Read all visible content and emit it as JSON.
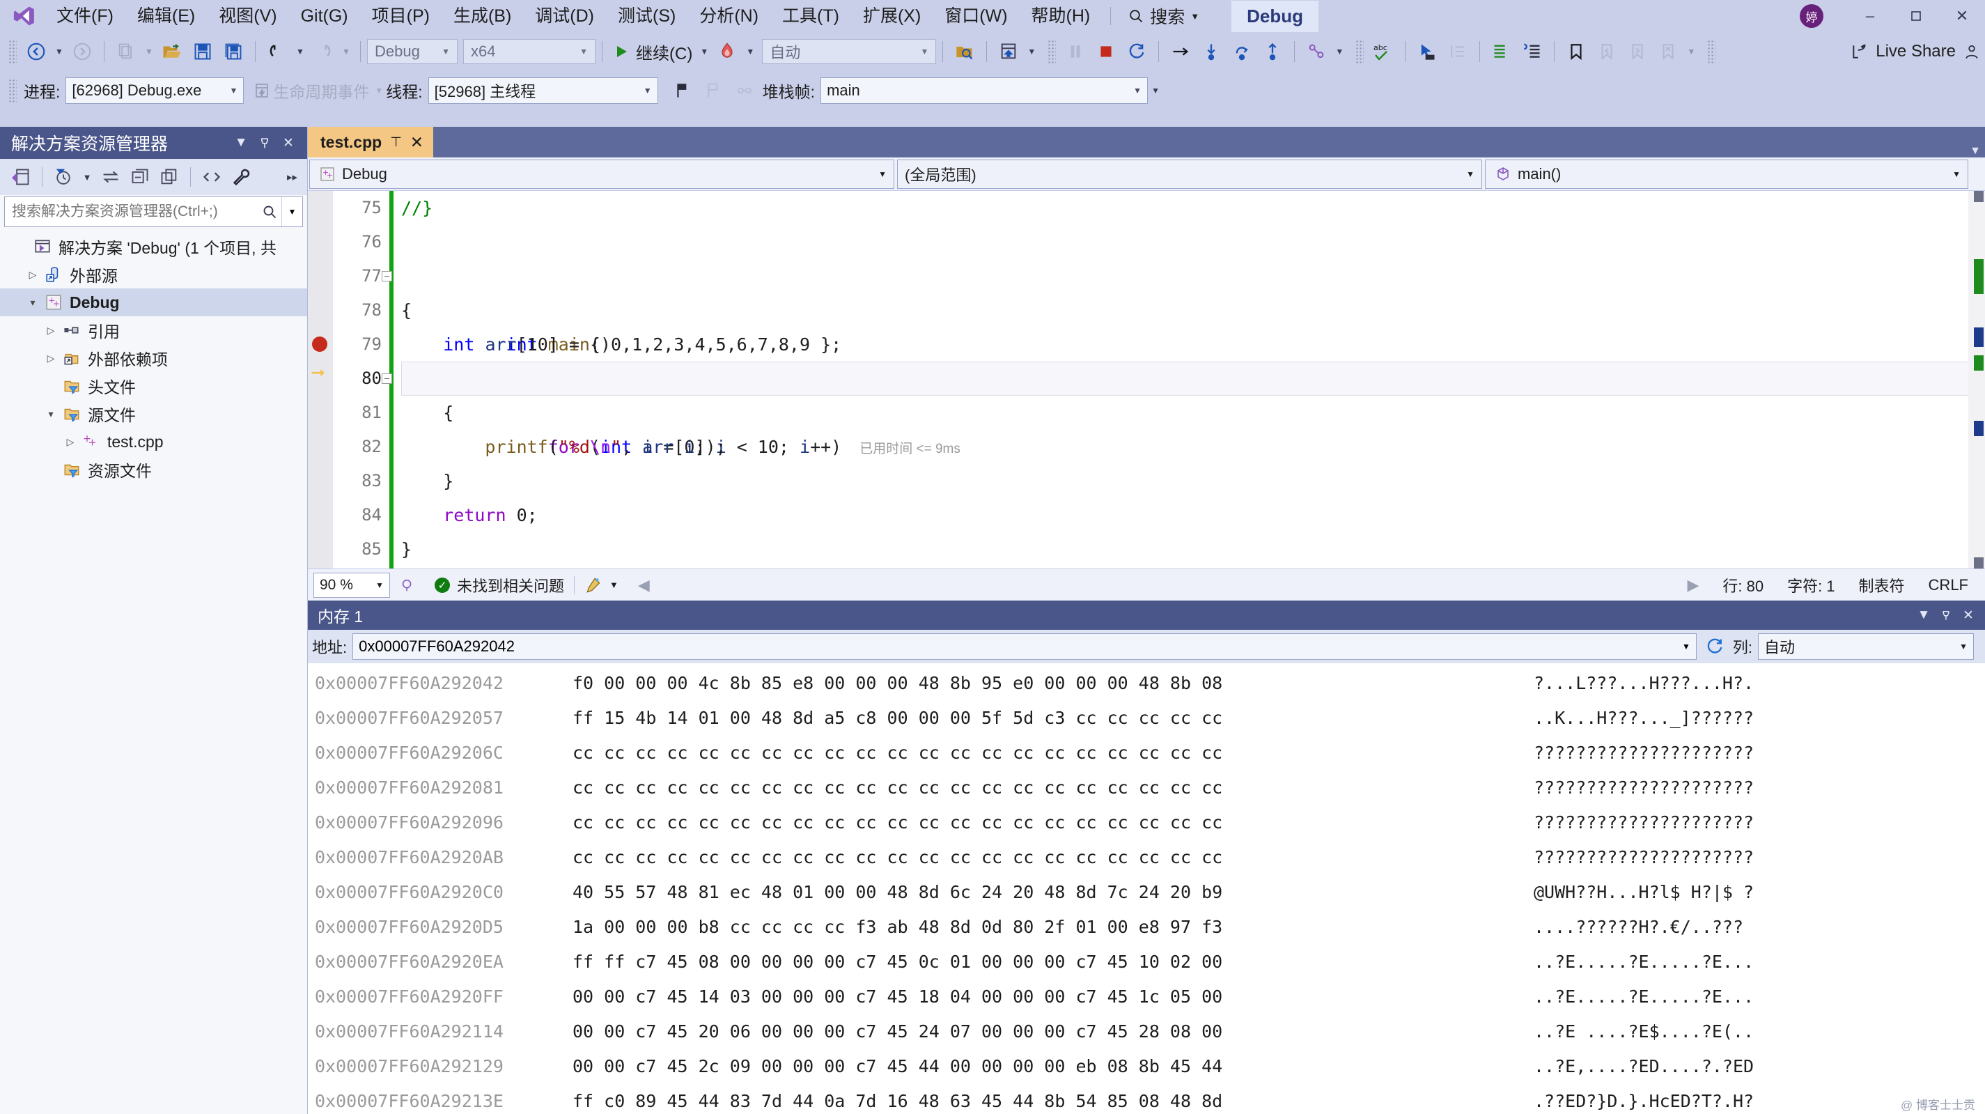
{
  "titlebar": {
    "logo_icon": "visual-studio-logo",
    "menus": [
      "文件(F)",
      "编辑(E)",
      "视图(V)",
      "Git(G)",
      "项目(P)",
      "生成(B)",
      "调试(D)",
      "测试(S)",
      "分析(N)",
      "工具(T)",
      "扩展(X)",
      "窗口(W)",
      "帮助(H)"
    ],
    "search_label": "搜索",
    "profile_tag": "Debug",
    "avatar_initial": "婷",
    "minimize_icon": "minimize-icon",
    "restore_icon": "restore-icon",
    "close_icon": "close-icon"
  },
  "toolbar": {
    "back_icon": "navigate-back-icon",
    "forward_icon": "navigate-forward-icon",
    "new_icon": "new-item-icon",
    "open_icon": "open-folder-icon",
    "save_icon": "save-icon",
    "save_all_icon": "save-all-icon",
    "undo_icon": "undo-icon",
    "redo_icon": "redo-icon",
    "config_value": "Debug",
    "platform_value": "x64",
    "continue_label": "继续(C)",
    "hot_reload_icon": "hot-reload-icon",
    "auto_value": "自动",
    "attach_icon": "attach-to-process-icon",
    "window_icon": "show-window-icon",
    "pause_icon": "pause-icon",
    "stop_icon": "stop-icon",
    "restart_icon": "restart-icon",
    "step_over_icon": "step-over-icon",
    "step_into_icon": "step-into-icon",
    "step_out_icon": "step-out-icon",
    "thread_icon": "threads-icon",
    "spell_icon": "spell-check-icon",
    "pointer_icon": "pointer-icon",
    "indent_icon": "indent-icon",
    "comment_icon": "comment-icon",
    "uncomment_icon": "uncomment-icon",
    "bookmark_icon": "bookmark-icon",
    "prev_bookmark_icon": "previous-bookmark-icon",
    "next_bookmark_icon": "next-bookmark-icon",
    "clear_bookmark_icon": "clear-bookmarks-icon",
    "live_share_label": "Live Share",
    "live_share_icon": "live-share-icon"
  },
  "debugbar": {
    "process_label": "进程:",
    "process_value": "[62968] Debug.exe",
    "lifecycle_label": "生命周期事件",
    "lifecycle_icon": "lifecycle-events-icon",
    "thread_label": "线程:",
    "thread_value": "[52968] 主线程",
    "flag_icon": "flag-icon",
    "flag2_icon": "flag-outline-icon",
    "link_icon": "link-icon",
    "stackframe_label": "堆栈帧:",
    "stackframe_value": "main"
  },
  "solution_explorer": {
    "title": "解决方案资源管理器",
    "dropdown_icon": "chevron-down-icon",
    "pin_icon": "pin-icon",
    "close_icon": "close-icon",
    "toolbar_icons": [
      "home-view-icon",
      "pending-changes-icon",
      "sync-icon",
      "collapse-all-icon",
      "show-all-files-icon",
      "code-view-icon",
      "properties-icon"
    ],
    "search_placeholder": "搜索解决方案资源管理器(Ctrl+;)",
    "search_icon": "search-icon",
    "tree": [
      {
        "label": "解决方案 'Debug' (1 个项目, 共",
        "icon": "solution-icon",
        "indent": 0,
        "arrow": "none",
        "bold": false,
        "selected": false
      },
      {
        "label": "外部源",
        "icon": "external-sources-icon",
        "indent": 1,
        "arrow": "collapsed",
        "bold": false,
        "selected": false
      },
      {
        "label": "Debug",
        "icon": "cpp-project-icon",
        "indent": 1,
        "arrow": "expanded",
        "bold": true,
        "selected": true
      },
      {
        "label": "引用",
        "icon": "references-icon",
        "indent": 2,
        "arrow": "collapsed",
        "bold": false,
        "selected": false
      },
      {
        "label": "外部依赖项",
        "icon": "external-dependencies-icon",
        "indent": 2,
        "arrow": "collapsed",
        "bold": false,
        "selected": false
      },
      {
        "label": "头文件",
        "icon": "filter-folder-icon",
        "indent": 2,
        "arrow": "none",
        "bold": false,
        "selected": false
      },
      {
        "label": "源文件",
        "icon": "filter-folder-icon",
        "indent": 2,
        "arrow": "expanded",
        "bold": false,
        "selected": false
      },
      {
        "label": "test.cpp",
        "icon": "cpp-file-icon",
        "indent": 3,
        "arrow": "collapsed",
        "bold": false,
        "selected": false
      },
      {
        "label": "资源文件",
        "icon": "filter-folder-icon",
        "indent": 2,
        "arrow": "none",
        "bold": false,
        "selected": false
      }
    ]
  },
  "editor": {
    "tab_label": "test.cpp",
    "tab_pin_icon": "pin-icon",
    "tab_close_icon": "close-icon",
    "project_scope": "Debug",
    "project_scope_icon": "cpp-project-icon",
    "global_scope": "(全局范围)",
    "member_scope": "main()",
    "member_scope_icon": "method-icon",
    "breakpoint_line": 79,
    "current_line": 80,
    "elapsed_label": "已用时间 <= 9ms",
    "lines": [
      {
        "no": 75,
        "html": "<span class=\"cmt\">//}</span>",
        "text": "//}"
      },
      {
        "no": 76,
        "html": "",
        "text": ""
      },
      {
        "no": 77,
        "html": "<span class=\"kw\">int</span> <span class=\"fn\">main</span>()",
        "text": "int main()"
      },
      {
        "no": 78,
        "html": "{",
        "text": "{"
      },
      {
        "no": 79,
        "html": "    <span class=\"kw\">int</span> <span class=\"var\">arr</span>[10] = { 0,1,2,3,4,5,6,7,8,9 };",
        "text": "    int arr[10] = { 0,1,2,3,4,5,6,7,8,9 };"
      },
      {
        "no": 80,
        "html": "    <span class=\"kw2\">for</span> (<span class=\"kw\">int</span> <span class=\"var\">i</span> = 0; <span class=\"var\">i</span> &lt; 10; <span class=\"var\">i</span>++)",
        "text": "    for (int i = 0; i < 10; i++)"
      },
      {
        "no": 81,
        "html": "    {",
        "text": "    {"
      },
      {
        "no": 82,
        "html": "        <span class=\"fn\">printf</span>(<span class=\"str\">\"%d</span><span class=\"esc\">\\n</span><span class=\"str\">\"</span>, <span class=\"var\">arr</span>[<span class=\"var\">i</span>]);",
        "text": "        printf(\"%d\\n\", arr[i]);"
      },
      {
        "no": 83,
        "html": "    }",
        "text": "    }"
      },
      {
        "no": 84,
        "html": "    <span class=\"kw2\">return</span> 0;",
        "text": "    return 0;"
      },
      {
        "no": 85,
        "html": "}",
        "text": "}"
      }
    ],
    "status": {
      "zoom": "90 %",
      "zoom_icon": "zoom-icon",
      "issues": "未找到相关问题",
      "issues_icon": "check-circle-icon",
      "cleanup_icon": "code-cleanup-icon",
      "prev_icon": "previous-icon",
      "next_icon": "next-icon",
      "line_label": "行: 80",
      "char_label": "字符: 1",
      "tab_label": "制表符",
      "eol_label": "CRLF"
    }
  },
  "memory_window": {
    "title": "内存 1",
    "dropdown_icon": "chevron-down-icon",
    "pin_icon": "pin-icon",
    "close_icon": "close-icon",
    "address_label": "地址:",
    "address_value": "0x00007FF60A292042",
    "refresh_icon": "refresh-icon",
    "columns_label": "列:",
    "columns_value": "自动",
    "watermark": "@ 博客士士贡",
    "rows": [
      {
        "address": "0x00007FF60A292042",
        "hex": "f0 00 00 00 4c 8b 85 e8 00 00 00 48 8b 95 e0 00 00 00 48 8b 08",
        "ascii": "?...L???...H???...H?."
      },
      {
        "address": "0x00007FF60A292057",
        "hex": "ff 15 4b 14 01 00 48 8d a5 c8 00 00 00 5f 5d c3 cc cc cc cc cc",
        "ascii": "..K...H???..._]??????"
      },
      {
        "address": "0x00007FF60A29206C",
        "hex": "cc cc cc cc cc cc cc cc cc cc cc cc cc cc cc cc cc cc cc cc cc",
        "ascii": "?????????????????????"
      },
      {
        "address": "0x00007FF60A292081",
        "hex": "cc cc cc cc cc cc cc cc cc cc cc cc cc cc cc cc cc cc cc cc cc",
        "ascii": "?????????????????????"
      },
      {
        "address": "0x00007FF60A292096",
        "hex": "cc cc cc cc cc cc cc cc cc cc cc cc cc cc cc cc cc cc cc cc cc",
        "ascii": "?????????????????????"
      },
      {
        "address": "0x00007FF60A2920AB",
        "hex": "cc cc cc cc cc cc cc cc cc cc cc cc cc cc cc cc cc cc cc cc cc",
        "ascii": "?????????????????????"
      },
      {
        "address": "0x00007FF60A2920C0",
        "hex": "40 55 57 48 81 ec 48 01 00 00 48 8d 6c 24 20 48 8d 7c 24 20 b9",
        "ascii": "@UWH??H...H?l$ H?|$ ?"
      },
      {
        "address": "0x00007FF60A2920D5",
        "hex": "1a 00 00 00 b8 cc cc cc cc f3 ab 48 8d 0d 80 2f 01 00 e8 97 f3",
        "ascii": "....??????H?.€/..???"
      },
      {
        "address": "0x00007FF60A2920EA",
        "hex": "ff ff c7 45 08 00 00 00 00 c7 45 0c 01 00 00 00 c7 45 10 02 00",
        "ascii": "..?E.....?E.....?E..."
      },
      {
        "address": "0x00007FF60A2920FF",
        "hex": "00 00 c7 45 14 03 00 00 00 c7 45 18 04 00 00 00 c7 45 1c 05 00",
        "ascii": "..?E.....?E.....?E..."
      },
      {
        "address": "0x00007FF60A292114",
        "hex": "00 00 c7 45 20 06 00 00 00 c7 45 24 07 00 00 00 c7 45 28 08 00",
        "ascii": "..?E ....?E$....?E(.."
      },
      {
        "address": "0x00007FF60A292129",
        "hex": "00 00 c7 45 2c 09 00 00 00 c7 45 44 00 00 00 00 eb 08 8b 45 44",
        "ascii": "..?E,....?ED....?.?ED"
      },
      {
        "address": "0x00007FF60A29213E",
        "hex": "ff c0 89 45 44 83 7d 44 0a 7d 16 48 63 45 44 8b 54 85 08 48 8d",
        "ascii": ".??ED?}D.}.HcED?T?.H?"
      }
    ]
  }
}
